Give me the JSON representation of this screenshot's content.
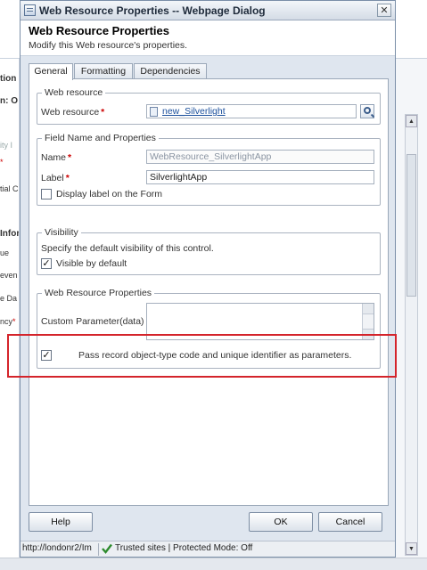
{
  "background": {
    "fragments": [
      "tion",
      "n: O",
      "ity I",
      "*",
      "tial C",
      "Infor",
      "ue",
      "even",
      "e Da",
      "ncy",
      "*"
    ]
  },
  "dialog": {
    "title": "Web Resource Properties -- Webpage Dialog",
    "close_glyph": "✕",
    "header": {
      "title": "Web Resource Properties",
      "subtitle": "Modify this Web resource's properties."
    },
    "tabs": [
      {
        "label": "General",
        "active": true
      },
      {
        "label": "Formatting",
        "active": false
      },
      {
        "label": "Dependencies",
        "active": false
      }
    ],
    "web_resource": {
      "legend": "Web resource",
      "label": "Web resource",
      "required_mark": "*",
      "value": "new_Silverlight",
      "lookup_icon": "lookup-search-icon"
    },
    "field_name": {
      "legend": "Field Name and Properties",
      "name_label": "Name",
      "name_required": "*",
      "name_value": "WebResource_SilverlightApp",
      "label_label": "Label",
      "label_required": "*",
      "label_value": "SilverlightApp",
      "display_label_text": "Display label on the Form",
      "display_label_checked": false
    },
    "visibility": {
      "legend": "Visibility",
      "description": "Specify the default visibility of this control.",
      "visible_text": "Visible by default",
      "visible_checked": true
    },
    "wr_properties": {
      "legend": "Web Resource Properties",
      "custom_param_label": "Custom Parameter(data)",
      "custom_param_value": "",
      "pass_record_text": "Pass record object-type code and unique identifier as parameters.",
      "pass_record_checked": true
    },
    "buttons": {
      "help": "Help",
      "ok": "OK",
      "cancel": "Cancel"
    },
    "check_glyph": "✓",
    "statusbar": {
      "url": "http://londonr2/Im",
      "zone": "Trusted sites | Protected Mode: Off"
    },
    "highlight_color": "#d4242b"
  }
}
